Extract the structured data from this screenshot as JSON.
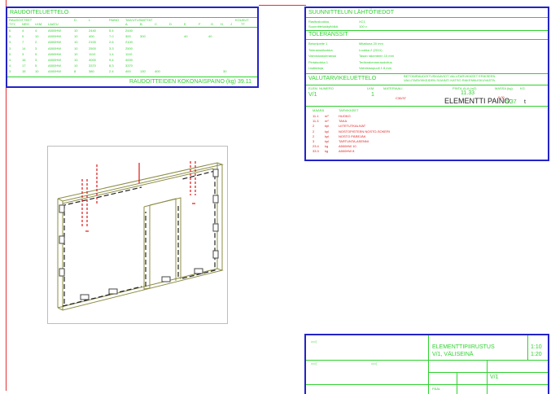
{
  "rebar_list": {
    "title": "RAUDOITELUETTELO",
    "col_headers": [
      "RAUDOITTEET",
      "TYY",
      "NRO",
      "LKM",
      "LAATU",
      "D",
      "L",
      "PAINO",
      "TAIVUTUSMITTAT",
      "A",
      "B",
      "C",
      "D",
      "E",
      "F",
      "G",
      "H",
      "J",
      "TT",
      "KOUKUT"
    ],
    "rows": [
      [
        "6",
        "4",
        "4",
        "A500HW",
        "10",
        "2440",
        "5.4",
        "2440"
      ],
      [
        "8",
        "5",
        "10",
        "A500HW",
        "10",
        "400",
        "7.0",
        "300",
        "300",
        "40",
        "40"
      ],
      [
        "3",
        "7",
        "2",
        "A500HW",
        "10",
        "2100",
        "2.6",
        "2100"
      ],
      [
        "3",
        "14",
        "3",
        "A500HW",
        "10",
        "2500",
        "3.3",
        "2500"
      ],
      [
        "5",
        "3",
        "5",
        "A500HW",
        "10",
        "1110",
        "1.4",
        "1110"
      ],
      [
        "4",
        "16",
        "3",
        "A500HW",
        "10",
        "4000",
        "9.4",
        "4000"
      ],
      [
        "4",
        "17",
        "5",
        "A500HW",
        "10",
        "3370",
        "8.3",
        "3370"
      ],
      [
        "3",
        "15",
        "10",
        "A500HW",
        "8",
        "380",
        "2.4",
        "400",
        "130",
        "400",
        "30"
      ]
    ],
    "total_label": "RAUDOITTEIDEN KOKONAISPAINO (kg)",
    "total_value": "39.11"
  },
  "design_info": {
    "title": "SUUNNITTELUN LÄHTÖTIEDOT",
    "rows": [
      [
        "Rasitusluokka",
        "XC1"
      ],
      [
        "Suunnittelukäyttöikä",
        "100 v"
      ]
    ],
    "sub_title": "TOLERANSSIT",
    "tol_rows": [
      [
        "Betonipeite 1",
        "Mitattuna 20 mm"
      ],
      [
        "Toleranssiluokka",
        "Luokka 2 (2011)"
      ],
      [
        "Valmistustoleranssi",
        "Tasan rakenteen 10 mm"
      ],
      [
        "Pintaluokka 1",
        "Teräsrakenneraudoitus"
      ],
      [
        "Lisätietoja",
        "Valmistuspuoli 1.8 mm"
      ]
    ],
    "mat_title": "VALUTARVIKELUETTELO",
    "mat_note1": "BETONIRAUDOITUSKAAVIOT VALUTARVIKKEET ERIKSEEN",
    "mat_note2": "VALUTARVIKKEIDEN SIJAINTI KATSO RAKENNUSKUVASTA",
    "mat_headers": [
      "ELEM. NUMERO",
      "LKM",
      "MATERIAALI",
      "PINTA-ALA (m2)",
      "MASSA (kg)",
      "KG"
    ],
    "mat_row": [
      "V/1",
      "1",
      "C30/37",
      "11.33",
      "0.00"
    ],
    "weight_label": "ELEMENTTI PAINO:",
    "weight_value": "5.37",
    "weight_unit": "t",
    "acc_headers": [
      "MÄÄRÄ",
      "TARVIKKEET"
    ],
    "acc_rows": [
      [
        "11.1",
        "m²",
        "HUOKO"
      ],
      [
        "11.3",
        "m²",
        "TAKA"
      ],
      [
        "2",
        "kpl",
        "LIITETUTKALIVAT"
      ],
      [
        "2",
        "kpl",
        "NOSTOPISTEEN NOSTO-SOKERI"
      ],
      [
        "2",
        "kpl",
        "NOSTO PÄREJÄK"
      ],
      [
        "3",
        "kpl",
        "TARTUNTA-ASENNI"
      ],
      [
        "23.4",
        "kg",
        "A500HW 10"
      ],
      [
        "33.3",
        "kg",
        "A500HW 8"
      ]
    ]
  },
  "title_block": {
    "title1": "ELEMENTTIPIIRUSTUS",
    "title2": "V/1, VÄLISEINÄ",
    "scale1": "1:10",
    "scale2": "1:20",
    "code": "V/1",
    "bottom_label": "PÄÄL"
  },
  "colors": {
    "frame": "#2323c8",
    "text": "#2fd12f",
    "accent": "#e01818",
    "drawing": "#7a7a3a"
  }
}
